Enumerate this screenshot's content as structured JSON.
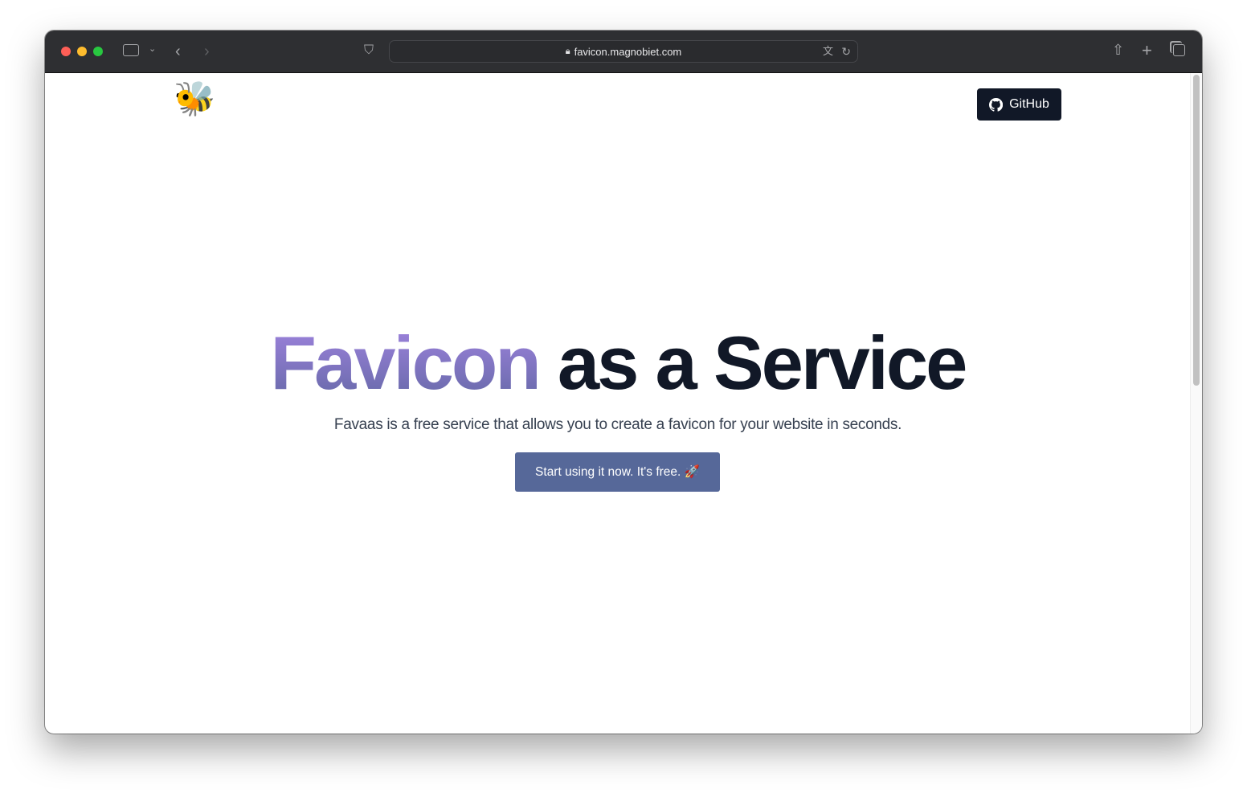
{
  "browser": {
    "url": "favicon.magnobiet.com",
    "icons": [
      "sidebar-icon",
      "chevron-down-icon",
      "back-icon",
      "forward-icon",
      "shield-icon",
      "lock-icon",
      "translate-icon",
      "reload-icon",
      "share-icon",
      "new-tab-icon",
      "tabs-icon"
    ]
  },
  "header": {
    "logo": "🐝",
    "github_label": "GitHub"
  },
  "hero": {
    "title_highlight": "Favicon",
    "title_rest": "as a Service",
    "subtitle": "Favaas is a free service that allows you to create a favicon for your website in seconds.",
    "cta_label": "Start using it now. It's free. 🚀"
  },
  "colors": {
    "cta": "#566899",
    "dark": "#111827",
    "gradient_top": "#a184e0",
    "gradient_bottom": "#6468a6"
  }
}
